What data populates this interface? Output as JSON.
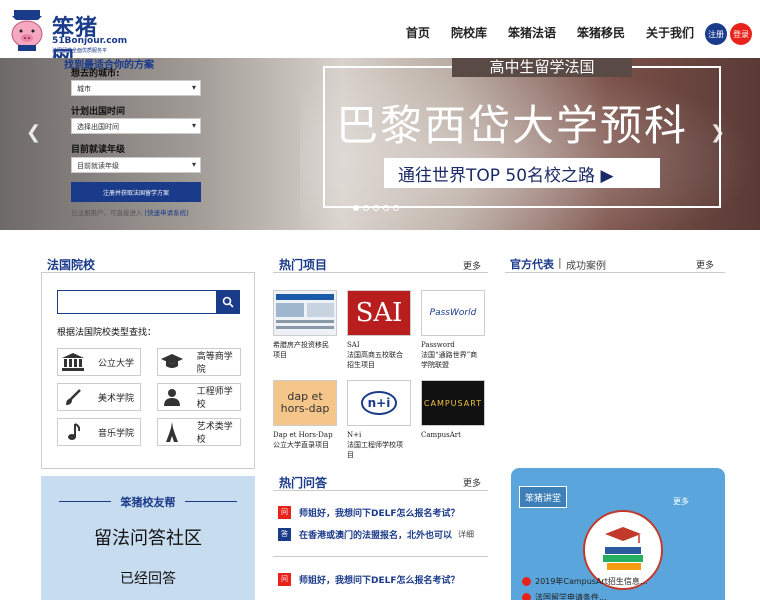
{
  "header": {
    "brand": "笨猪网",
    "domain": "51Bonjour.com",
    "tagline": "法国留学全面优质服务平台",
    "nav": [
      "首页",
      "院校库",
      "笨猪法语",
      "笨猪移民",
      "关于我们"
    ],
    "register_label": "注册",
    "login_label": "登录"
  },
  "banner": {
    "form_caption": "找到最适合你的方案",
    "city_label": "想去的城市:",
    "city_value": "城市",
    "time_label": "计划出国时间",
    "time_value": "选择出国时间",
    "grade_label": "目前就读年级",
    "grade_value": "目前就读年级",
    "submit_label": "注册并获取法国留学方案",
    "note_prefix": "已注册用户，可直接进入 ",
    "note_link": "[快速申请系统]",
    "subtitle": "高中生留学法国",
    "title": "巴黎西岱大学预科",
    "pill": "通往世界TOP 50名校之路 ▶",
    "prev_icon": "chevron-left-icon",
    "next_icon": "chevron-right-icon",
    "active_dot": 0,
    "dot_count": 5
  },
  "schools": {
    "title": "法国院校",
    "hint": "根据法国院校类型查找：",
    "categories": [
      {
        "label": "公立大学",
        "icon": "university-icon"
      },
      {
        "label": "高等商学院",
        "icon": "graduation-cap-icon"
      },
      {
        "label": "美术学院",
        "icon": "paintbrush-icon"
      },
      {
        "label": "工程师学校",
        "icon": "engineer-icon"
      },
      {
        "label": "音乐学院",
        "icon": "music-note-icon"
      },
      {
        "label": "艺术类学校",
        "icon": "eiffel-tower-icon"
      }
    ]
  },
  "helper": {
    "heading": "笨猪校友帮",
    "title": "留法问答社区",
    "subtitle": "已经回答"
  },
  "projects": {
    "title": "热门项目",
    "more": "更多",
    "items": [
      {
        "line1": "希腊房产投资移民",
        "line2": "项目",
        "line3": "",
        "thumb_text": ""
      },
      {
        "line1": "SAI",
        "line2": "法国高商五校联合",
        "line3": "招生项目",
        "thumb_text": "SAI"
      },
      {
        "line1": "Password",
        "line2": "法国“通路世界”商",
        "line3": "学院联盟",
        "thumb_text": "PassWorld"
      },
      {
        "line1": "Dap et Hors-Dap",
        "line2": "公立大学直录项目",
        "line3": "",
        "thumb_text": "dap et hors-dap"
      },
      {
        "line1": "N+i",
        "line2": "法国工程师学校项",
        "line3": "目",
        "thumb_text": "n+i"
      },
      {
        "line1": "CampusArt",
        "line2": "",
        "line3": "",
        "thumb_text": "CAMPUSART"
      }
    ]
  },
  "qa": {
    "title": "热门问答",
    "more": "更多",
    "items": [
      {
        "mark": "问",
        "text": "师姐好，我想问下DELF怎么报名考试？",
        "color": "#e8231b"
      },
      {
        "mark": "答",
        "text": "在香港或澳门的法盟报名，北外也可以",
        "color": "#1a3a8a",
        "detail": "详细"
      },
      {
        "mark": "问",
        "text": "师姐好，我想问下DELF怎么报名考试？",
        "color": "#e8231b"
      }
    ]
  },
  "reps": {
    "tab1": "官方代表",
    "sep": "|",
    "tab2": "成功案例",
    "more": "更多"
  },
  "lecture": {
    "tab": "笨猪讲堂",
    "more": "更多",
    "items": [
      "2019年CampusArt招生信息...",
      "法国留学申请条件..."
    ]
  },
  "colors": {
    "brand": "#1a3a8a",
    "accent": "#e8231b",
    "lecture": "#5aa6dc",
    "helper": "#c8dcef"
  }
}
